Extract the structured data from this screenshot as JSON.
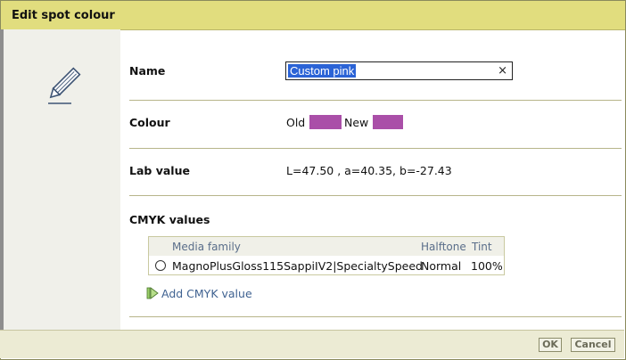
{
  "dialog": {
    "title": "Edit spot colour"
  },
  "icons": {
    "edit": "pencil-icon",
    "add": "add-arrow-icon"
  },
  "name": {
    "label": "Name",
    "value": "Custom pink",
    "clear": "×"
  },
  "colour": {
    "label": "Colour",
    "old_label": "Old",
    "new_label": "New",
    "old_color": "#aa4fa8",
    "new_color": "#aa4fa8"
  },
  "lab": {
    "label": "Lab value",
    "value": "L=47.50 , a=40.35, b=-27.43"
  },
  "cmyk": {
    "label": "CMYK values",
    "columns": {
      "media_family": "Media family",
      "halftone": "Halftone",
      "tint": "Tint"
    },
    "rows": [
      {
        "media_family": "MagnoPlusGloss115SappiIV2|SpecialtySpeed",
        "halftone": "Normal",
        "tint": "100%"
      }
    ],
    "add_label": "Add CMYK value"
  },
  "footer": {
    "ok": "OK",
    "cancel": "Cancel"
  },
  "colors": {
    "titlebar": "#e1dd7e",
    "selection": "#2b63d6",
    "link": "#3f6291"
  }
}
